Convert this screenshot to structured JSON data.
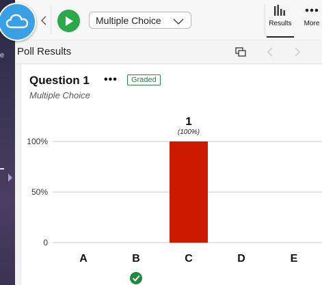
{
  "toolbar": {
    "question_type": "Multiple Choice",
    "results_label": "Results",
    "more_label": "More"
  },
  "results_header": {
    "title": "Poll Results"
  },
  "question": {
    "title": "Question 1",
    "badge": "Graded",
    "subtitle": "Multiple Choice"
  },
  "colors": {
    "accent_green": "#2aa84a",
    "bar": "#cc1a00",
    "badge": "#1e8a3e",
    "cloud": "#3aa0e6"
  },
  "chart_data": {
    "type": "bar",
    "categories": [
      "A",
      "B",
      "C",
      "D",
      "E"
    ],
    "values": [
      0,
      0,
      1,
      0,
      0
    ],
    "percents": [
      0,
      0,
      100,
      0,
      0
    ],
    "value_labels": [
      "",
      "",
      "1",
      "",
      ""
    ],
    "percent_labels": [
      "",
      "",
      "(100%)",
      "",
      ""
    ],
    "yticks": [
      "0",
      "50%",
      "100%"
    ],
    "ylim": [
      0,
      100
    ],
    "correct": "B",
    "grid": true
  }
}
